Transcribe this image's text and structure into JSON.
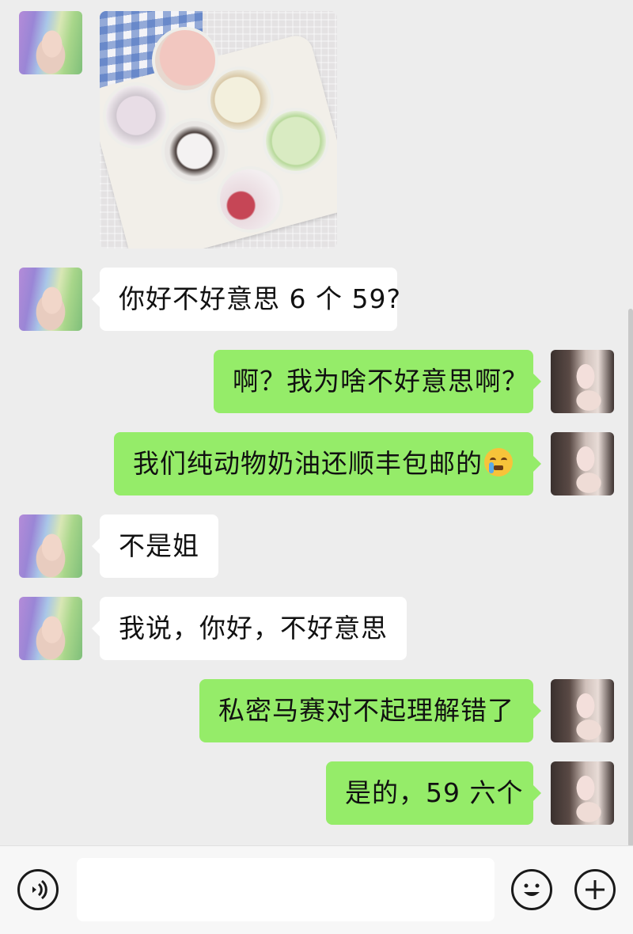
{
  "messages": [
    {
      "id": "m0",
      "side": "in",
      "type": "image",
      "image_desc": "ice cream cups on tray"
    },
    {
      "id": "m1",
      "side": "in",
      "text": "你好不好意思 6 个 59?"
    },
    {
      "id": "m2",
      "side": "out",
      "text": "啊？我为啥不好意思啊？"
    },
    {
      "id": "m3",
      "side": "out",
      "text": "我们纯动物奶油还顺丰包邮的",
      "emoji": "crying-face"
    },
    {
      "id": "m4",
      "side": "in",
      "text": "不是姐"
    },
    {
      "id": "m5",
      "side": "in",
      "text": "我说，你好，不好意思"
    },
    {
      "id": "m6",
      "side": "out",
      "text": "私密马赛对不起理解错了"
    },
    {
      "id": "m7",
      "side": "out",
      "text": "是的，59 六个"
    }
  ],
  "input": {
    "placeholder": ""
  },
  "icons": {
    "voice": "voice-icon",
    "emoji": "emoji-icon",
    "plus": "plus-icon"
  },
  "colors": {
    "background": "#ededed",
    "incoming_bubble": "#ffffff",
    "outgoing_bubble": "#95ec69"
  }
}
